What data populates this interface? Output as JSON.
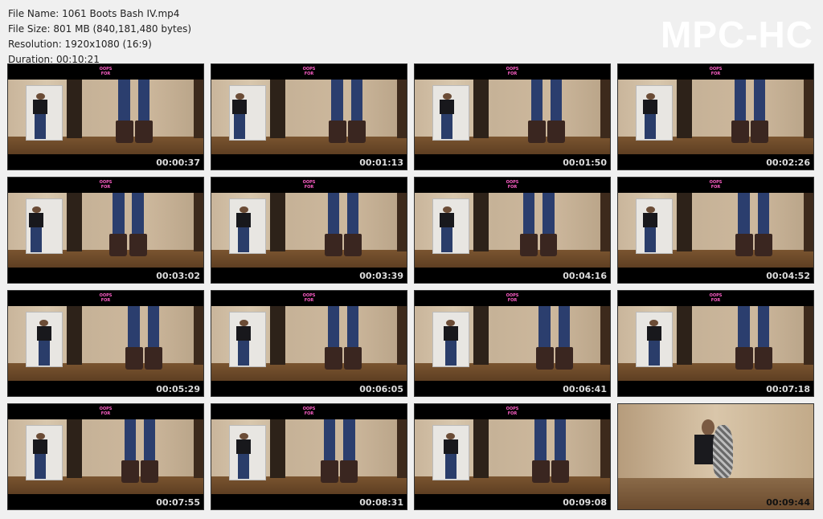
{
  "file_info": {
    "name": "File Name: 1061 Boots Bash IV.mp4",
    "size": "File Size: 801 MB (840,181,480 bytes)",
    "resolution": "Resolution: 1920x1080 (16:9)",
    "duration": "Duration: 00:10:21"
  },
  "brand": "MPC-HC",
  "overlay_logo": "OOPS\nFOR",
  "thumbnails": [
    {
      "timestamp": "00:00:37"
    },
    {
      "timestamp": "00:01:13"
    },
    {
      "timestamp": "00:01:50"
    },
    {
      "timestamp": "00:02:26"
    },
    {
      "timestamp": "00:03:02"
    },
    {
      "timestamp": "00:03:39"
    },
    {
      "timestamp": "00:04:16"
    },
    {
      "timestamp": "00:04:52"
    },
    {
      "timestamp": "00:05:29"
    },
    {
      "timestamp": "00:06:05"
    },
    {
      "timestamp": "00:06:41"
    },
    {
      "timestamp": "00:07:18"
    },
    {
      "timestamp": "00:07:55"
    },
    {
      "timestamp": "00:08:31"
    },
    {
      "timestamp": "00:09:08"
    },
    {
      "timestamp": "00:09:44"
    }
  ],
  "colors": {
    "background": "#f0f0f0",
    "brand_text": "#ffffff",
    "timestamp_text": "#dcdcdc",
    "logo_pink": "#ff5fc8"
  }
}
